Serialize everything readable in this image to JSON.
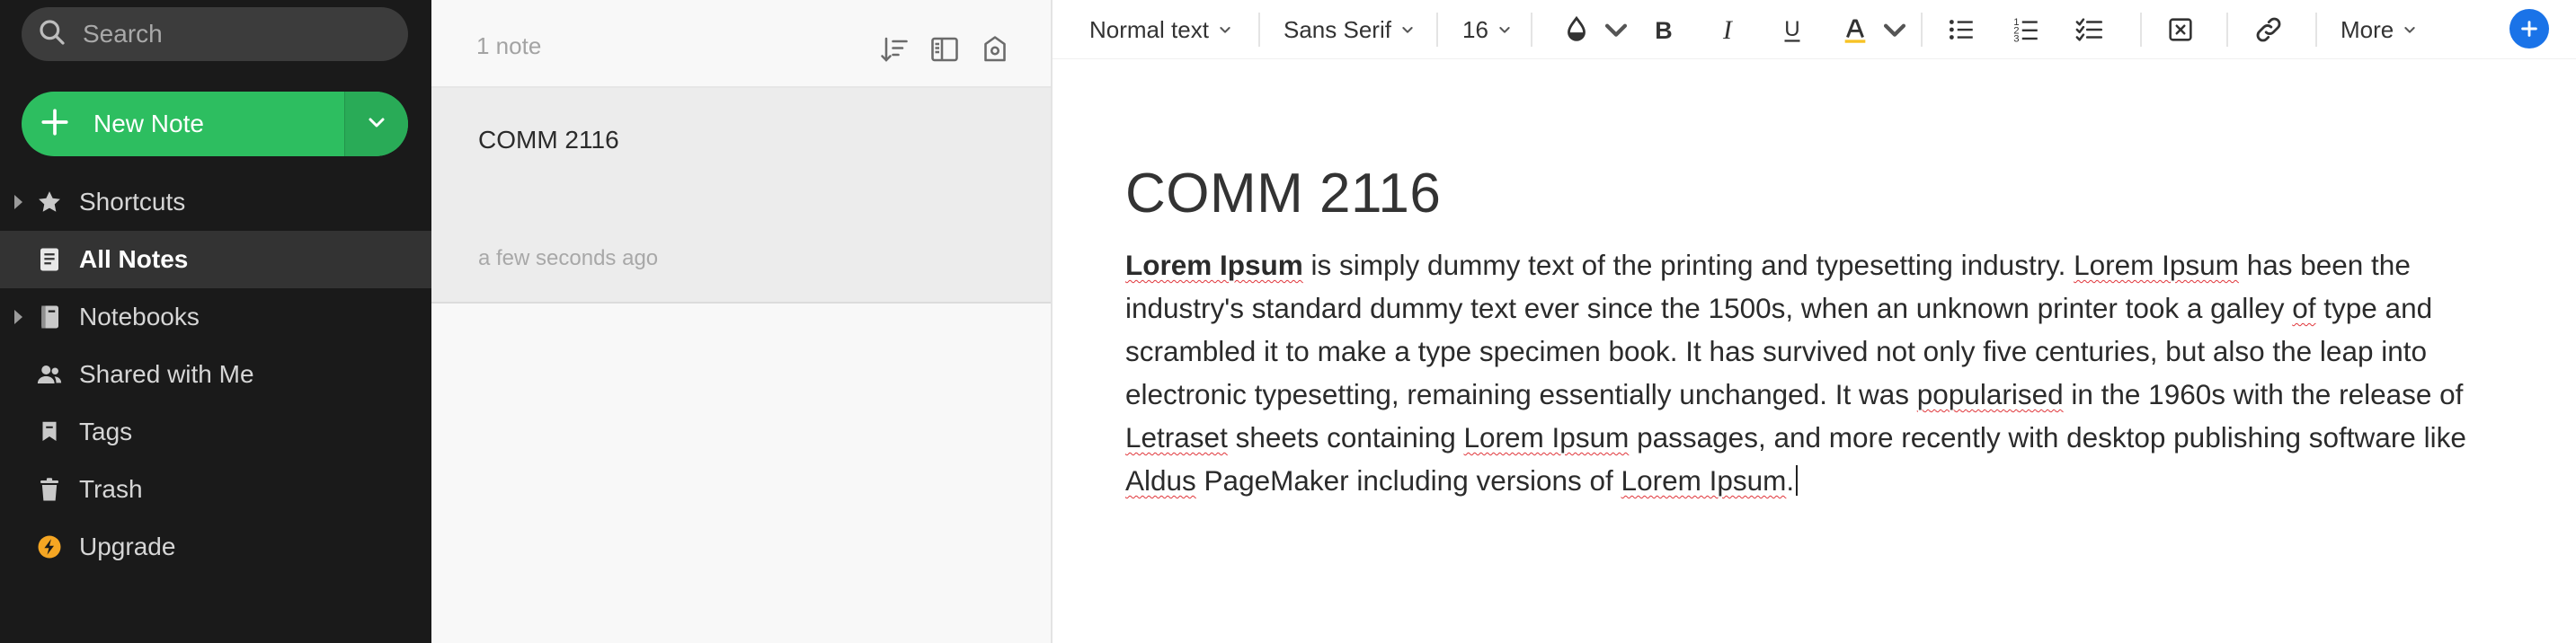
{
  "sidebar": {
    "search_placeholder": "Search",
    "new_note_label": "New Note",
    "nav": [
      {
        "label": "Shortcuts",
        "icon": "star-icon",
        "expandable": true
      },
      {
        "label": "All Notes",
        "icon": "notes-icon",
        "active": true
      },
      {
        "label": "Notebooks",
        "icon": "notebook-icon",
        "expandable": true
      },
      {
        "label": "Shared with Me",
        "icon": "users-icon"
      },
      {
        "label": "Tags",
        "icon": "tag-icon"
      },
      {
        "label": "Trash",
        "icon": "trash-icon"
      },
      {
        "label": "Upgrade",
        "icon": "upgrade-icon"
      }
    ]
  },
  "note_list": {
    "count": "1 note",
    "notes": [
      {
        "title": "COMM 2116",
        "time": "a few seconds ago"
      }
    ]
  },
  "toolbar": {
    "style": "Normal text",
    "font": "Sans Serif",
    "size": "16",
    "more": "More"
  },
  "editor": {
    "title": "COMM 2116",
    "body": {
      "t1": "Lorem Ipsum",
      "t2": " is simply dummy text of the printing and typesetting industry. ",
      "t3": "Lorem Ipsum",
      "t4": " has been the industry's standard dummy text ever since the 1500s, when an unknown printer took a galley ",
      "t5": "of",
      "t6": " type and scrambled it to make a type specimen book. It has survived not only five centuries, but also the leap into electronic typesetting, remaining essentially unchanged. It was ",
      "t7": "popularised",
      "t8": " in the 1960s with the release of ",
      "t9": "Letraset",
      "t10": " sheets containing ",
      "t11": "Lorem Ipsum",
      "t12": " passages, and more recently with desktop publishing software like ",
      "t13": "Aldus",
      "t14": " PageMaker including versions of ",
      "t15": "Lorem Ipsum",
      "t16": "."
    }
  },
  "colors": {
    "sidebar_bg": "#1a1a1a",
    "accent_green": "#2dbe60",
    "upgrade_orange": "#f5a623",
    "highlight_yellow": "#f7c325",
    "plus_blue": "#1a73e8",
    "spell_red": "#e0353a"
  }
}
